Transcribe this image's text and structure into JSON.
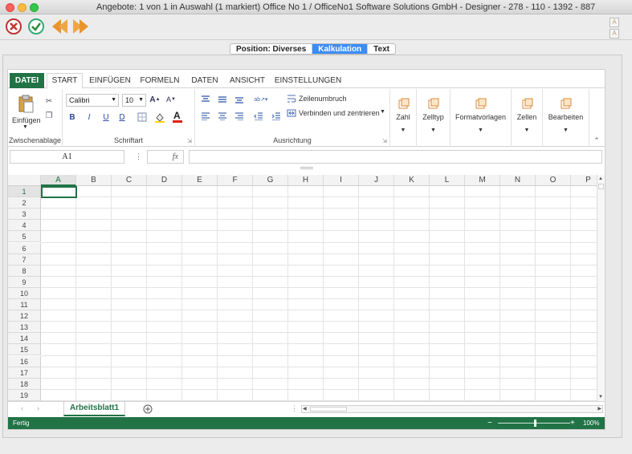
{
  "window": {
    "title": "Angebote: 1 von 1 in Auswahl  (1 markiert) Office No 1 /  OfficeNo1 Software Solutions GmbH - Designer - 278 - 110 - 1392 - 887"
  },
  "segments": [
    {
      "label": "Position: Diverses",
      "active": false
    },
    {
      "label": "Kalkulation",
      "active": true
    },
    {
      "label": "Text",
      "active": false
    }
  ],
  "ribbon_tabs": {
    "file": "DATEI",
    "start": "START",
    "insert": "EINFÜGEN",
    "formulas": "FORMELN",
    "data": "DATEN",
    "view": "ANSICHT",
    "settings": "EINSTELLUNGEN"
  },
  "clipboard": {
    "paste": "Einfügen",
    "label": "Zwischenablage"
  },
  "font": {
    "name": "Calibri",
    "size": "10",
    "label": "Schriftart",
    "bold": "B",
    "italic": "I",
    "underline": "U",
    "double_underline": "D"
  },
  "alignment": {
    "wrap": "Zeilenumbruch",
    "merge": "Verbinden und zentrieren",
    "label": "Ausrichtung"
  },
  "groups": {
    "number": "Zahl",
    "celltype": "Zelltyp",
    "styles": "Formatvorlagen",
    "cells": "Zellen",
    "edit": "Bearbeiten"
  },
  "formula_bar": {
    "cell_ref": "A1",
    "fx": "fx",
    "value": ""
  },
  "sheet": {
    "columns": [
      "A",
      "B",
      "C",
      "D",
      "E",
      "F",
      "G",
      "H",
      "I",
      "J",
      "K",
      "L",
      "M",
      "N",
      "O",
      "P"
    ],
    "rows": [
      "1",
      "2",
      "3",
      "4",
      "5",
      "6",
      "7",
      "8",
      "9",
      "10",
      "11",
      "12",
      "13",
      "14",
      "15",
      "16",
      "17",
      "18",
      "19"
    ],
    "active_tab": "Arbeitsblatt1"
  },
  "status": {
    "text": "Fertig",
    "zoom": "100%",
    "zoom_fraction": 0.5
  },
  "colors": {
    "excel_green": "#217346",
    "segment_blue": "#3b8cf5"
  }
}
